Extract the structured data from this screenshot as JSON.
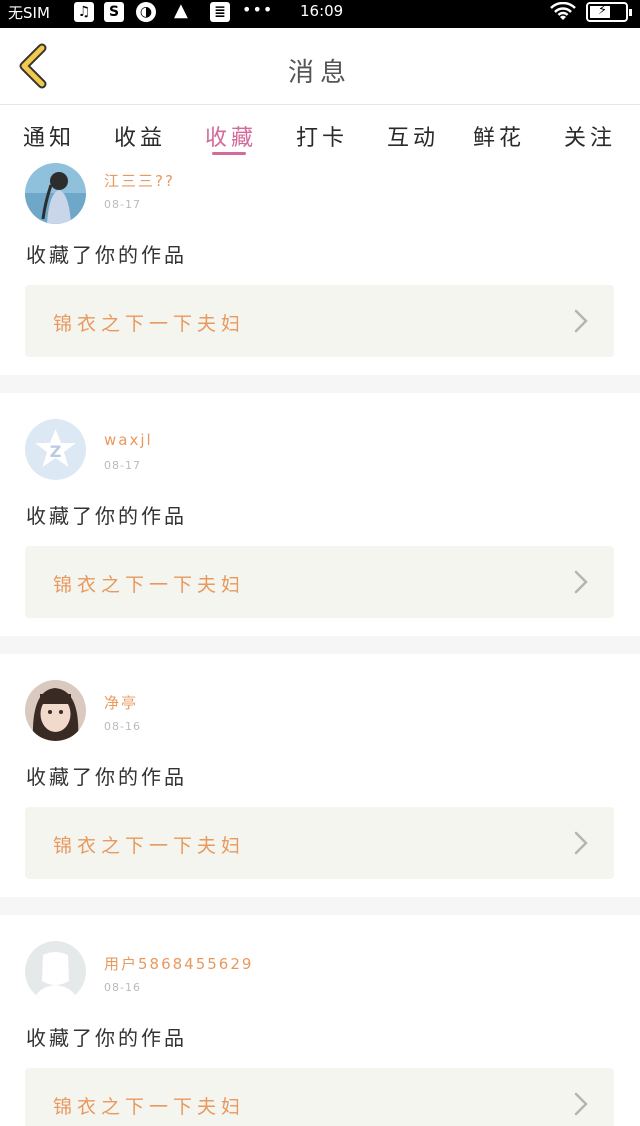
{
  "status_bar": {
    "carrier": "无SIM",
    "icons": [
      "music-icon",
      "s-icon",
      "chat-icon",
      "warning-icon",
      "storage-icon"
    ],
    "more": "•••",
    "time": "16:09"
  },
  "header": {
    "title": "消息",
    "back_icon": "chevron-left-icon",
    "accent": "#f2c94c"
  },
  "tabs": [
    {
      "label": "通知"
    },
    {
      "label": "收益"
    },
    {
      "label": "收藏",
      "active": true
    },
    {
      "label": "打卡"
    },
    {
      "label": "互动"
    },
    {
      "label": "鲜花"
    },
    {
      "label": "关注"
    }
  ],
  "active_color": "#d46a9a",
  "items": [
    {
      "name": "江三三??",
      "date": "08-17",
      "action": "收藏了你的作品",
      "work": "锦衣之下一下夫妇",
      "avatar": "photo-avatar-blue"
    },
    {
      "name": "waxjl",
      "date": "08-17",
      "action": "收藏了你的作品",
      "work": "锦衣之下一下夫妇",
      "avatar": "qzone-avatar"
    },
    {
      "name": "净亭",
      "date": "08-16",
      "action": "收藏了你的作品",
      "work": "锦衣之下一下夫妇",
      "avatar": "photo-avatar-girl"
    },
    {
      "name": "用户5868455629",
      "date": "08-16",
      "action": "收藏了你的作品",
      "work": "锦衣之下一下夫妇",
      "avatar": "default-avatar"
    }
  ]
}
